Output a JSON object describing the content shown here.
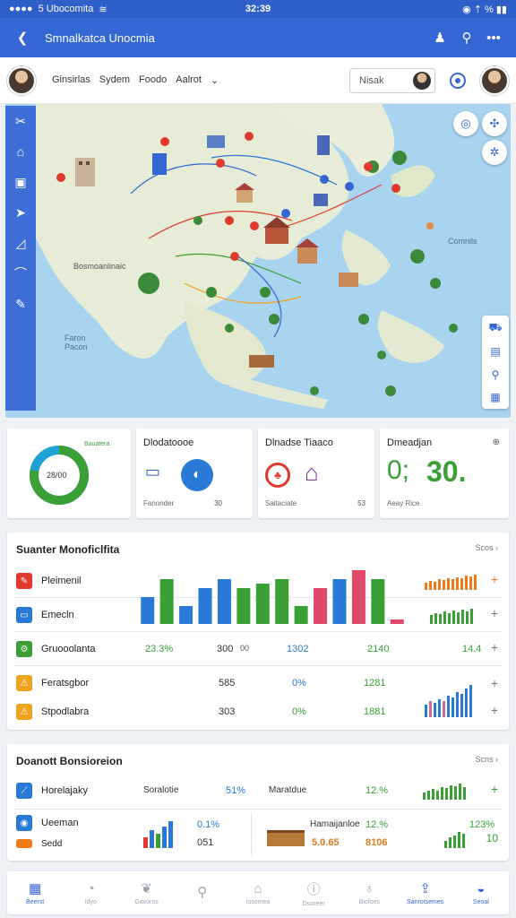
{
  "status_bar": {
    "carrier": "5 Ubocomita",
    "time": "32:39",
    "icons": "◉ ⇡ % ▮▮"
  },
  "app_bar": {
    "title": "Smnalkatca Unocmia",
    "back_icon": "back-arrow-icon"
  },
  "filter_bar": {
    "filters": [
      "Ginsirlas",
      "Sydem",
      "Foodo",
      "Aalrot"
    ],
    "search_value": "Nisak"
  },
  "map": {
    "ocean_label": "Comnils",
    "region_label": "Bosmoanlinaic",
    "sea_label": "Faron Pacon"
  },
  "cards": {
    "donut": {
      "center_text": "28/00",
      "top_label": "Bauatera",
      "percent": 78
    },
    "card2": {
      "title": "Dlodatoooe",
      "left_label": "Fanonder",
      "right_value": "30"
    },
    "card3": {
      "title": "Dlnadse Tiaaco",
      "left_label": "Saitaciate",
      "right_value": "53"
    },
    "card4": {
      "title": "Dmeadjan",
      "big_left": "0;",
      "big_right": "30.",
      "left_label": "Aeay Rice"
    }
  },
  "panel1": {
    "title": "Suanter Monoficlfita",
    "more": "Scos",
    "rows": [
      {
        "label": "Pleimenil",
        "color": "#e03a2e"
      },
      {
        "label": "Emecln",
        "color": "#2a79d6"
      },
      {
        "label": "Gruooolanta",
        "color": "#3aa036"
      },
      {
        "label": "Feratsgbor",
        "color": "#f0a21c"
      },
      {
        "label": "Stpodlabra",
        "color": "#f0a21c"
      }
    ],
    "values": {
      "row3_a": "23.3%",
      "row3_b": "300",
      "row3_c": "00",
      "row3_d": "1302",
      "row3_e": "2140",
      "row3_f": "14.4",
      "row4_a": "585",
      "row4_b": "0%",
      "row4_c": "1281",
      "row5_a": "303",
      "row5_b": "0%",
      "row5_c": "1881"
    },
    "chart_data": {
      "type": "bar",
      "series": [
        {
          "values": [
            6,
            10,
            4,
            8,
            10,
            8,
            9,
            10,
            4,
            8,
            10,
            12,
            10,
            1
          ]
        }
      ],
      "colors": [
        "#2a79d6",
        "#3aa036",
        "#2a79d6",
        "#2a79d6",
        "#2a79d6",
        "#3aa036",
        "#3aa036",
        "#3aa036",
        "#3aa036",
        "#e04a6a",
        "#2a79d6",
        "#e04a6a",
        "#3aa036",
        "#e04a6a"
      ]
    }
  },
  "panel2": {
    "title": "Doanott Bonsioreion",
    "more": "Scns",
    "row1": {
      "label": "Horelajaky",
      "mid": "Soralotie",
      "pct": "51%",
      "name": "Maratdue",
      "value": "12.%"
    },
    "row2": {
      "label": "Ueeman",
      "label2": "Sedd",
      "pct": "0.1%",
      "val": "051",
      "name": "Hamaijanloe",
      "name_pct": "12.%",
      "v1": "5.0.65",
      "v2": "8106",
      "right_pct": "123%"
    }
  },
  "nav": [
    "Beerst",
    "Idyo",
    "Gavoros",
    "",
    "Issomea",
    "Dsoreer",
    "Biofoes",
    "Sanrotsemes",
    "Seoal"
  ]
}
